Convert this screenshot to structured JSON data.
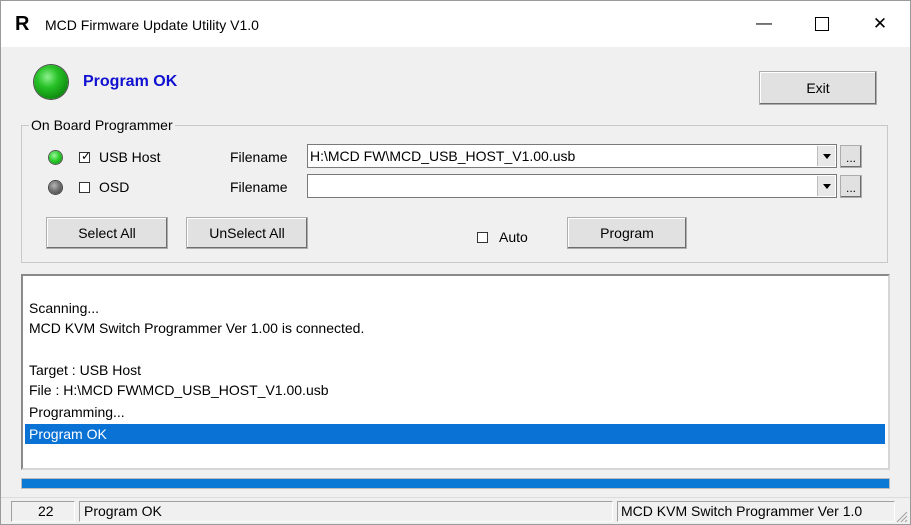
{
  "window": {
    "icon_glyph": "R",
    "title": "MCD Firmware Update Utility V1.0",
    "minimize_glyph": "—",
    "close_glyph": "✕"
  },
  "header": {
    "status_text": "Program OK",
    "status_led": "green-led-icon",
    "exit_label": "Exit"
  },
  "programmer": {
    "group_label": "On Board Programmer",
    "rows": [
      {
        "led": "on",
        "checked": true,
        "check_label": "USB Host",
        "filename_label": "Filename",
        "filename_value": "H:\\MCD FW\\MCD_USB_HOST_V1.00.usb",
        "browse_label": "..."
      },
      {
        "led": "off",
        "checked": false,
        "check_label": "OSD",
        "filename_label": "Filename",
        "filename_value": "",
        "browse_label": "..."
      }
    ],
    "select_all_label": "Select All",
    "unselect_all_label": "UnSelect All",
    "auto_label": "Auto",
    "auto_checked": false,
    "program_label": "Program"
  },
  "log": {
    "lines": [
      "Scanning...",
      "MCD KVM Switch Programmer Ver 1.00 is connected.",
      "",
      "Target : USB Host",
      "File : H:\\MCD FW\\MCD_USB_HOST_V1.00.usb",
      "Programming...",
      "Program OK"
    ],
    "selected_index": 6
  },
  "progress": {
    "percent": 100,
    "color": "#0a79d6"
  },
  "statusbar": {
    "count": "22",
    "message": "Program OK",
    "version": "MCD KVM Switch Programmer Ver 1.0"
  },
  "colors": {
    "status_text": "#1010d0",
    "selection": "#0a72d4",
    "led_on": "#27c227",
    "led_off": "#6e6e6e"
  }
}
